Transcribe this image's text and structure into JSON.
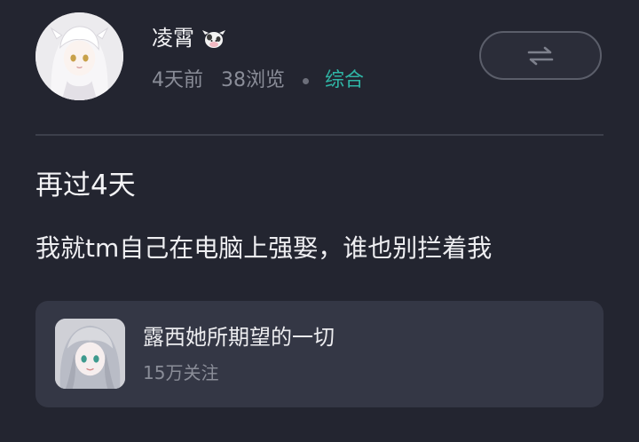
{
  "author": {
    "name": "凌霄",
    "avatar_icon": "user-avatar-icon",
    "badge_icon": "cow-badge-icon"
  },
  "meta": {
    "time": "4天前",
    "views": "38浏览",
    "category": "综合",
    "category_color": "#2fb5a5"
  },
  "actions": {
    "switch_icon": "swap-arrows-icon"
  },
  "post": {
    "title": "再过4天",
    "body": "我就tm自己在电脑上强娶，谁也别拦着我"
  },
  "game_card": {
    "name": "露西她所期望的一切",
    "followers": "15万关注",
    "thumb_icon": "game-cover-icon"
  },
  "colors": {
    "background": "#232530",
    "card": "#343745",
    "accent": "#2fb5a5"
  }
}
